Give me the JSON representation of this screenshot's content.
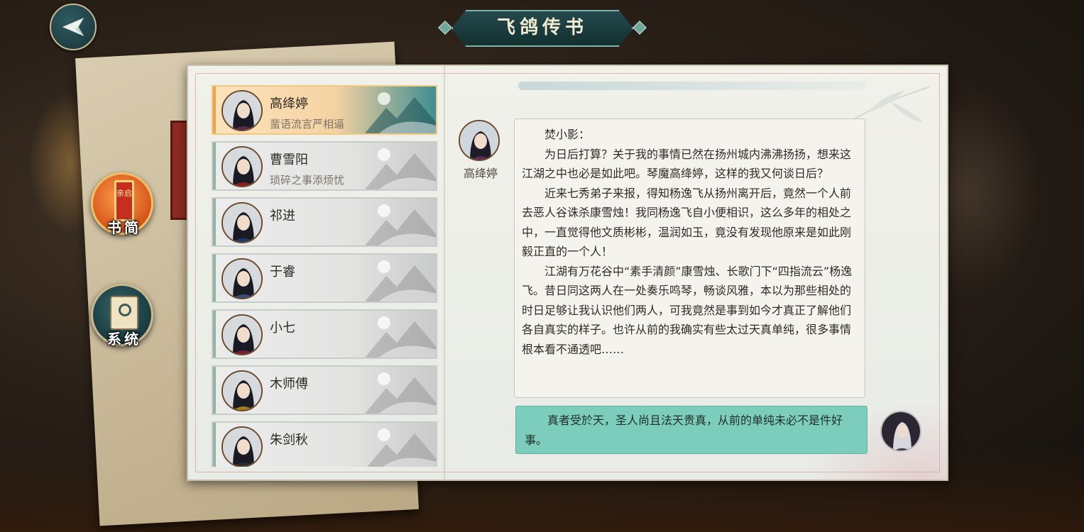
{
  "header": {
    "title": "飞鸽传书",
    "back_icon": "paper-plane-back-icon"
  },
  "side_menu": {
    "letters_label": "书简",
    "letters_badge": "亲启",
    "system_label": "系统"
  },
  "contacts": [
    {
      "name": "高绛婷",
      "subtitle": "蜚语流言严相逼",
      "active": true,
      "color": "#5a2a4a"
    },
    {
      "name": "曹雪阳",
      "subtitle": "琐碎之事添烦忧",
      "active": false,
      "color": "#8a1f1f"
    },
    {
      "name": "祁进",
      "subtitle": "",
      "active": false,
      "color": "#1f3a6a"
    },
    {
      "name": "于睿",
      "subtitle": "",
      "active": false,
      "color": "#3a4e7a"
    },
    {
      "name": "小七",
      "subtitle": "",
      "active": false,
      "color": "#7a1a3a"
    },
    {
      "name": "木师傅",
      "subtitle": "",
      "active": false,
      "color": "#a67c1e"
    },
    {
      "name": "朱剑秋",
      "subtitle": "",
      "active": false,
      "color": "#2b2b2b"
    }
  ],
  "chat": {
    "sender_name": "高绛婷",
    "incoming": {
      "greeting": "焚小影：",
      "paragraphs": [
        "为日后打算？关于我的事情已然在扬州城内沸沸扬扬，想来这江湖之中也必是如此吧。琴魔高绛婷，这样的我又何谈日后？",
        "近来七秀弟子来报，得知杨逸飞从扬州离开后，竟然一个人前去恶人谷诛杀康雪烛！我同杨逸飞自小便相识，这么多年的相处之中，一直觉得他文质彬彬，温润如玉，竟没有发现他原来是如此刚毅正直的一个人！",
        "江湖有万花谷中“素手清颜”康雪烛、长歌门下“四指流云”杨逸飞。昔日同这两人在一处奏乐鸣琴，畅谈风雅，本以为那些相处的时日足够让我认识他们两人，可我竟然是事到如今才真正了解他们各自真实的样子。也许从前的我确实有些太过天真单纯，很多事情根本看不通透吧……"
      ]
    },
    "outgoing": "真者受於天，圣人尚且法天贵真，从前的单纯未必不是件好事。"
  },
  "colors": {
    "accent_teal": "#24494e",
    "active_orange": "#f5d2a2",
    "reply_bubble": "#7ccdbb"
  }
}
